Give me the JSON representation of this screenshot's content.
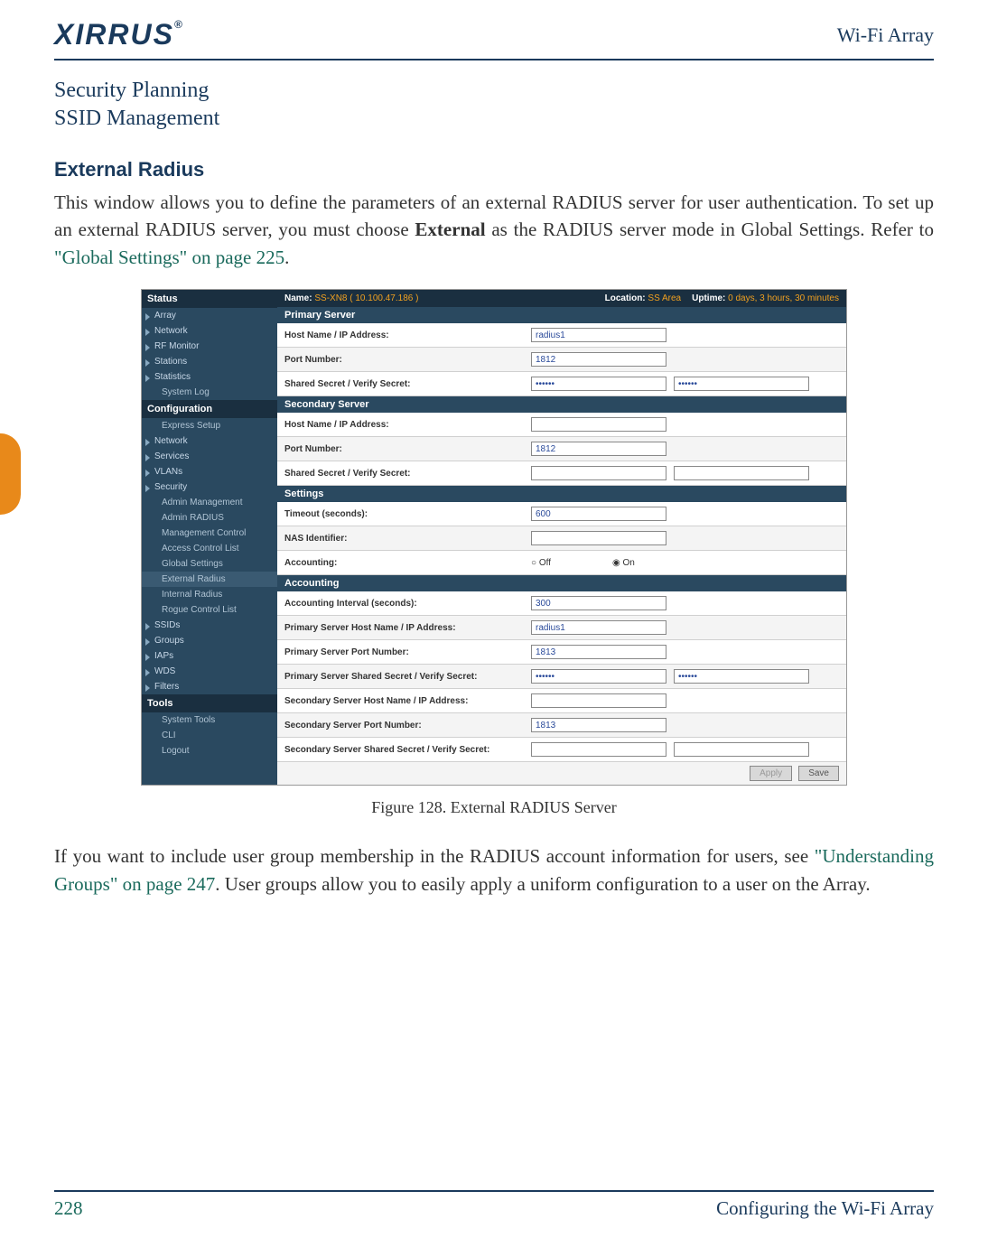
{
  "header": {
    "logo": "XIRRUS",
    "product": "Wi-Fi Array"
  },
  "breadcrumb": {
    "line1": "Security Planning",
    "line2": "SSID Management"
  },
  "section": {
    "heading": "External Radius",
    "para1_a": "This window allows you to define the parameters of an external RADIUS server for user authentication. To set up an external RADIUS server, you must choose ",
    "para1_b": "External",
    "para1_c": " as the RADIUS server mode in Global Settings. Refer to ",
    "para1_link": "\"Global Settings\" on page 225",
    "para1_d": "."
  },
  "screenshot": {
    "top": {
      "name_label": "Name:",
      "name_value": "SS-XN8   ( 10.100.47.186 )",
      "location_label": "Location:",
      "location_value": "SS Area",
      "uptime_label": "Uptime:",
      "uptime_value": "0 days, 3 hours, 30 minutes"
    },
    "nav": {
      "status": "Status",
      "status_items": [
        "Array",
        "Network",
        "RF Monitor",
        "Stations",
        "Statistics",
        "System Log"
      ],
      "configuration": "Configuration",
      "config_items": [
        "Express Setup",
        "Network",
        "Services",
        "VLANs",
        "Security"
      ],
      "security_items": [
        "Admin Management",
        "Admin RADIUS",
        "Management Control",
        "Access Control List",
        "Global Settings",
        "External Radius",
        "Internal Radius",
        "Rogue Control List"
      ],
      "after_security": [
        "SSIDs",
        "Groups",
        "IAPs",
        "WDS",
        "Filters"
      ],
      "tools": "Tools",
      "tools_items": [
        "System Tools",
        "CLI",
        "Logout"
      ]
    },
    "sections": {
      "primary": "Primary Server",
      "secondary": "Secondary Server",
      "settings": "Settings",
      "accounting": "Accounting"
    },
    "rows": {
      "hostip": "Host Name / IP Address:",
      "port": "Port Number:",
      "secret": "Shared Secret / Verify Secret:",
      "timeout": "Timeout (seconds):",
      "nas": "NAS Identifier:",
      "accounting_label": "Accounting:",
      "acct_interval": "Accounting Interval (seconds):",
      "pri_host": "Primary Server Host Name / IP Address:",
      "pri_port": "Primary Server Port Number:",
      "pri_secret": "Primary Server Shared Secret / Verify Secret:",
      "sec_host": "Secondary Server Host Name / IP Address:",
      "sec_port": "Secondary Server Port Number:",
      "sec_secret": "Secondary Server Shared Secret / Verify Secret:"
    },
    "values": {
      "primary_host": "radius1",
      "primary_port": "1812",
      "primary_secret": "••••••",
      "primary_verify": "••••••",
      "secondary_host": "",
      "secondary_port": "1812",
      "secondary_secret": "",
      "secondary_verify": "",
      "timeout": "600",
      "nas": "",
      "accounting_off": "Off",
      "accounting_on": "On",
      "acct_interval": "300",
      "acct_pri_host": "radius1",
      "acct_pri_port": "1813",
      "acct_pri_secret": "••••••",
      "acct_pri_verify": "••••••",
      "acct_sec_host": "",
      "acct_sec_port": "1813",
      "acct_sec_secret": "",
      "acct_sec_verify": ""
    },
    "buttons": {
      "apply": "Apply",
      "save": "Save"
    }
  },
  "figure_caption": "Figure 128. External RADIUS Server",
  "para2": {
    "a": "If you want to include user group membership in the RADIUS account information for users, see ",
    "link": "\"Understanding Groups\" on page 247",
    "b": ". User groups allow you to easily apply a uniform configuration to a user on the Array."
  },
  "footer": {
    "page": "228",
    "section": "Configuring the Wi-Fi Array"
  }
}
